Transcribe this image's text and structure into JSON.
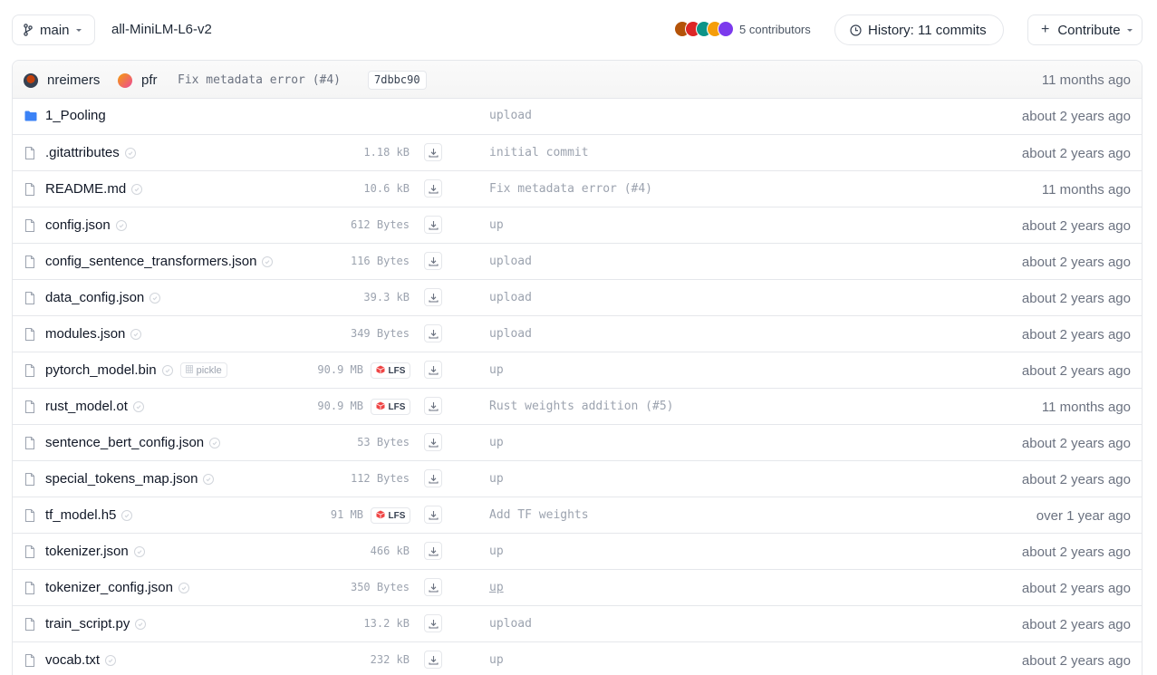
{
  "header": {
    "branch": "main",
    "repo_name": "all-MiniLM-L6-v2",
    "contributors_label": "5 contributors",
    "contributor_avatar_colors": [
      "#b45309",
      "#dc2626",
      "#0d9488",
      "#f59e0b",
      "#7c3aed"
    ],
    "history_label": "History: 11 commits",
    "contribute_label": "Contribute"
  },
  "last_commit": {
    "author1": "nreimers",
    "author2": "pfr",
    "message": "Fix metadata error (#4)",
    "sha": "7dbbc90",
    "time": "11 months ago"
  },
  "files": [
    {
      "name": "1_Pooling",
      "type": "folder",
      "size": "",
      "lfs": false,
      "pickle": false,
      "commit": "upload",
      "time": "about 2 years ago"
    },
    {
      "name": ".gitattributes",
      "type": "file",
      "size": "1.18 kB",
      "lfs": false,
      "pickle": false,
      "commit": "initial commit",
      "time": "about 2 years ago"
    },
    {
      "name": "README.md",
      "type": "file",
      "size": "10.6 kB",
      "lfs": false,
      "pickle": false,
      "commit": "Fix metadata error (#4)",
      "time": "11 months ago"
    },
    {
      "name": "config.json",
      "type": "file",
      "size": "612 Bytes",
      "lfs": false,
      "pickle": false,
      "commit": "up",
      "time": "about 2 years ago"
    },
    {
      "name": "config_sentence_transformers.json",
      "type": "file",
      "size": "116 Bytes",
      "lfs": false,
      "pickle": false,
      "commit": "upload",
      "time": "about 2 years ago"
    },
    {
      "name": "data_config.json",
      "type": "file",
      "size": "39.3 kB",
      "lfs": false,
      "pickle": false,
      "commit": "upload",
      "time": "about 2 years ago"
    },
    {
      "name": "modules.json",
      "type": "file",
      "size": "349 Bytes",
      "lfs": false,
      "pickle": false,
      "commit": "upload",
      "time": "about 2 years ago"
    },
    {
      "name": "pytorch_model.bin",
      "type": "file",
      "size": "90.9 MB",
      "lfs": true,
      "pickle": true,
      "pickle_label": "pickle",
      "commit": "up",
      "time": "about 2 years ago"
    },
    {
      "name": "rust_model.ot",
      "type": "file",
      "size": "90.9 MB",
      "lfs": true,
      "pickle": false,
      "commit": "Rust weights addition (#5)",
      "time": "11 months ago"
    },
    {
      "name": "sentence_bert_config.json",
      "type": "file",
      "size": "53 Bytes",
      "lfs": false,
      "pickle": false,
      "commit": "up",
      "time": "about 2 years ago"
    },
    {
      "name": "special_tokens_map.json",
      "type": "file",
      "size": "112 Bytes",
      "lfs": false,
      "pickle": false,
      "commit": "up",
      "time": "about 2 years ago"
    },
    {
      "name": "tf_model.h5",
      "type": "file",
      "size": "91 MB",
      "lfs": true,
      "pickle": false,
      "commit": "Add TF weights",
      "time": "over 1 year ago"
    },
    {
      "name": "tokenizer.json",
      "type": "file",
      "size": "466 kB",
      "lfs": false,
      "pickle": false,
      "commit": "up",
      "time": "about 2 years ago"
    },
    {
      "name": "tokenizer_config.json",
      "type": "file",
      "size": "350 Bytes",
      "lfs": false,
      "pickle": false,
      "commit": "up",
      "commit_underlined": true,
      "time": "about 2 years ago"
    },
    {
      "name": "train_script.py",
      "type": "file",
      "size": "13.2 kB",
      "lfs": false,
      "pickle": false,
      "commit": "upload",
      "time": "about 2 years ago"
    },
    {
      "name": "vocab.txt",
      "type": "file",
      "size": "232 kB",
      "lfs": false,
      "pickle": false,
      "commit": "up",
      "time": "about 2 years ago"
    }
  ],
  "lfs_label": "LFS",
  "icons": {
    "branch": "git-branch-icon",
    "clock": "clock-icon",
    "folder": "folder-icon",
    "file": "file-icon",
    "download": "download-icon",
    "lfs": "lfs-cube-icon",
    "safe": "check-shield-icon"
  },
  "colors": {
    "folder": "#3b82f6",
    "lfs_cube": "#ef4444",
    "border": "#e5e7eb",
    "muted_text": "#6b7280"
  }
}
